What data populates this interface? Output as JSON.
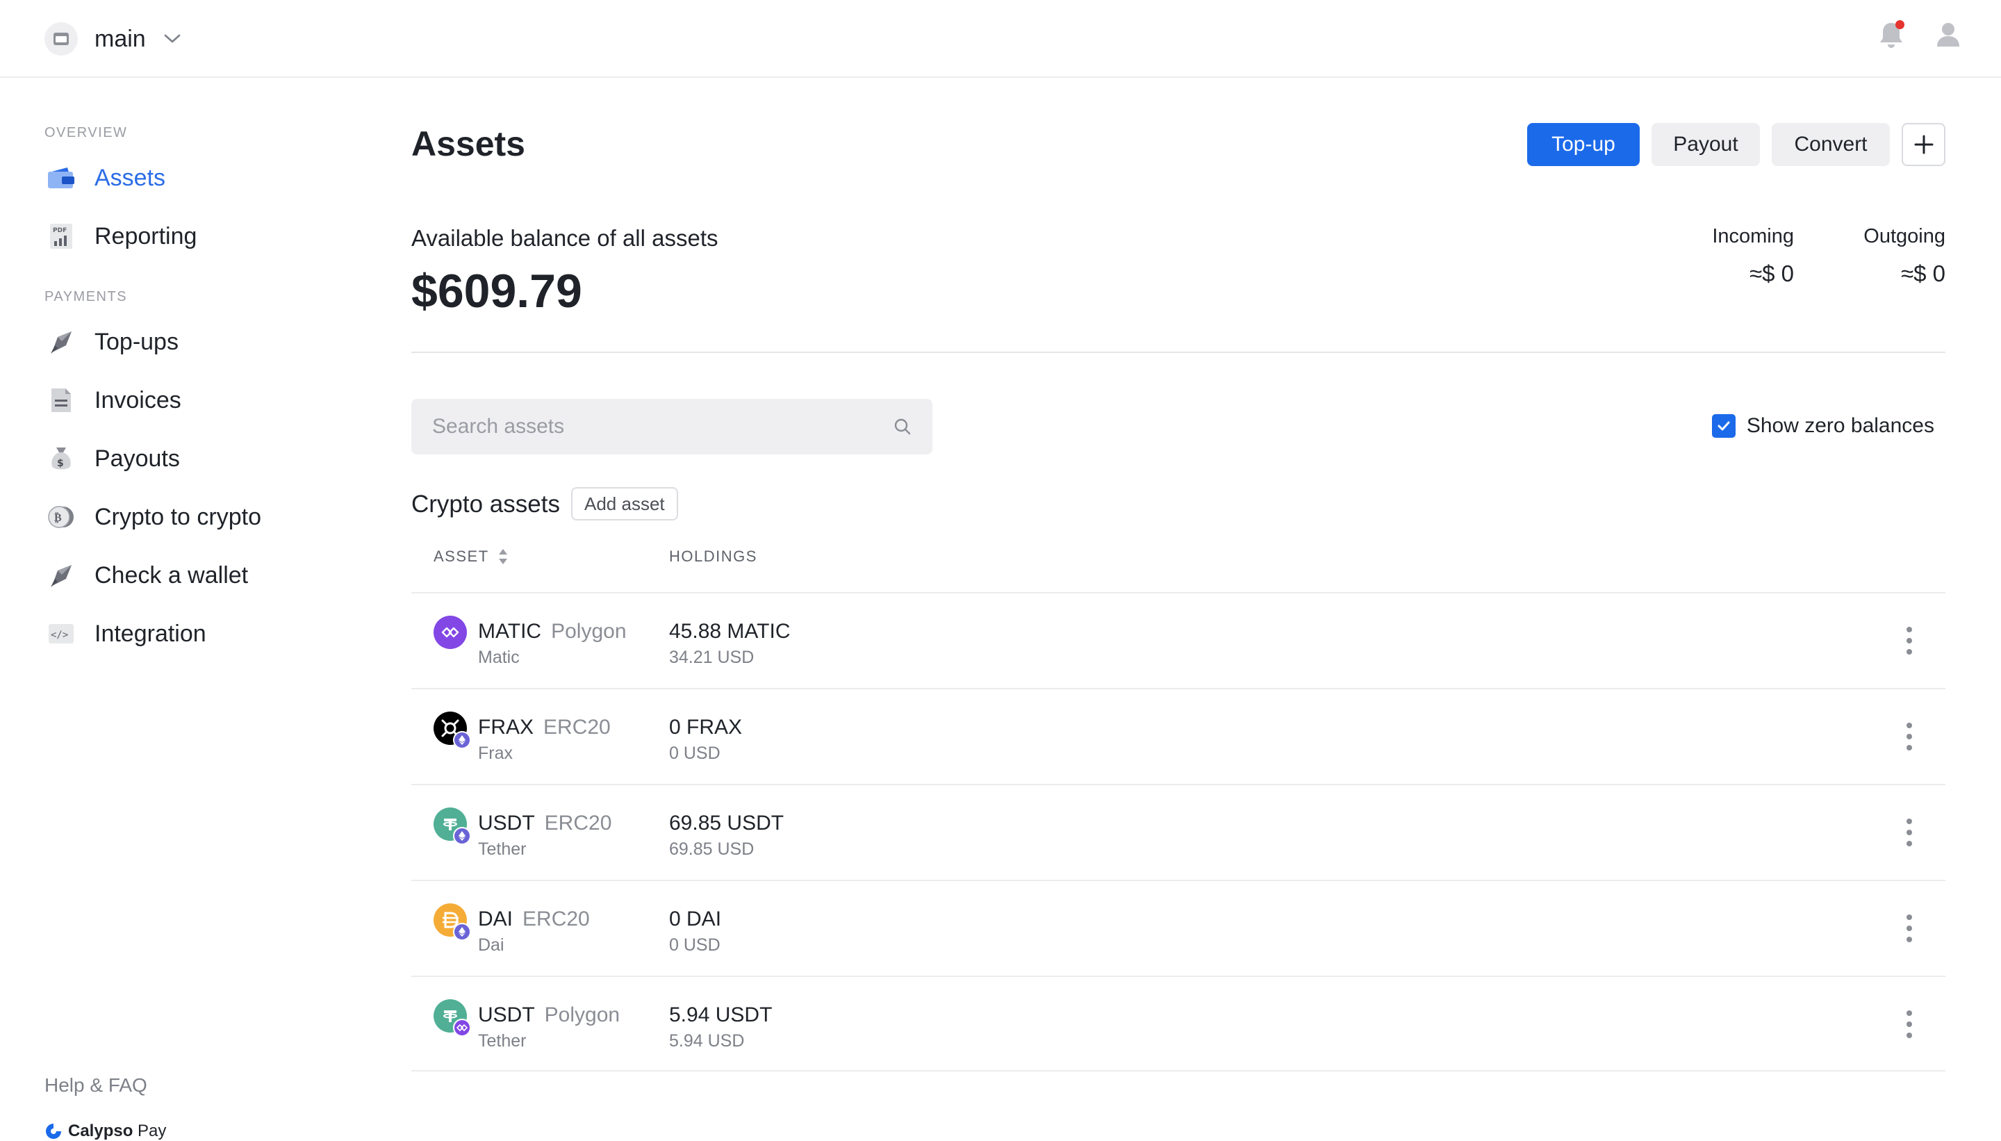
{
  "header": {
    "workspace_name": "main"
  },
  "sidebar": {
    "sections": [
      {
        "label": "OVERVIEW"
      },
      {
        "label": "PAYMENTS"
      }
    ],
    "items": [
      {
        "label": "Assets",
        "icon": "wallet-icon",
        "active": true
      },
      {
        "label": "Reporting",
        "icon": "pdf-report-icon"
      },
      {
        "label": "Top-ups",
        "icon": "top-up-icon"
      },
      {
        "label": "Invoices",
        "icon": "invoice-icon"
      },
      {
        "label": "Payouts",
        "icon": "money-bag-icon"
      },
      {
        "label": "Crypto to crypto",
        "icon": "coin-exchange-icon"
      },
      {
        "label": "Check a wallet",
        "icon": "check-wallet-icon"
      },
      {
        "label": "Integration",
        "icon": "code-icon"
      }
    ],
    "help_label": "Help & FAQ",
    "brand": {
      "name_bold": "Calypso",
      "name_light": " Pay"
    }
  },
  "main": {
    "title": "Assets",
    "actions": {
      "topup_label": "Top-up",
      "payout_label": "Payout",
      "convert_label": "Convert",
      "plus_label": "+"
    },
    "balance": {
      "label": "Available balance of all assets",
      "amount": "$609.79"
    },
    "incoming": {
      "label": "Incoming",
      "value": "≈$ 0"
    },
    "outgoing": {
      "label": "Outgoing",
      "value": "≈$ 0"
    },
    "search": {
      "placeholder": "Search assets"
    },
    "show_zero": {
      "label": "Show zero balances",
      "checked": true
    },
    "crypto": {
      "title": "Crypto assets",
      "add_label": "Add asset",
      "columns": [
        "ASSET",
        "HOLDINGS"
      ],
      "rows": [
        {
          "symbol": "MATIC",
          "network": "Polygon",
          "name": "Matic",
          "holdings": "45.88 MATIC",
          "usd": "34.21 USD",
          "icon": "matic-icon",
          "color": "#8247e5",
          "net_icon": ""
        },
        {
          "symbol": "FRAX",
          "network": "ERC20",
          "name": "Frax",
          "holdings": "0 FRAX",
          "usd": "0 USD",
          "icon": "frax-icon",
          "color": "#000000",
          "net_icon": "ethereum-icon"
        },
        {
          "symbol": "USDT",
          "network": "ERC20",
          "name": "Tether",
          "holdings": "69.85 USDT",
          "usd": "69.85 USD",
          "icon": "tether-icon",
          "color": "#50af95",
          "net_icon": "ethereum-icon"
        },
        {
          "symbol": "DAI",
          "network": "ERC20",
          "name": "Dai",
          "holdings": "0 DAI",
          "usd": "0 USD",
          "icon": "dai-icon",
          "color": "#f5ac37",
          "net_icon": "ethereum-icon"
        },
        {
          "symbol": "USDT",
          "network": "Polygon",
          "name": "Tether",
          "holdings": "5.94 USDT",
          "usd": "5.94 USD",
          "icon": "tether-icon",
          "color": "#50af95",
          "net_icon": "polygon-icon"
        }
      ]
    }
  },
  "colors": {
    "accent": "#1b6aea",
    "active_nav": "#2a6ce6",
    "notification": "#e5332d",
    "ethereum_badge": "#6a63d6",
    "polygon_badge": "#8247e5"
  }
}
